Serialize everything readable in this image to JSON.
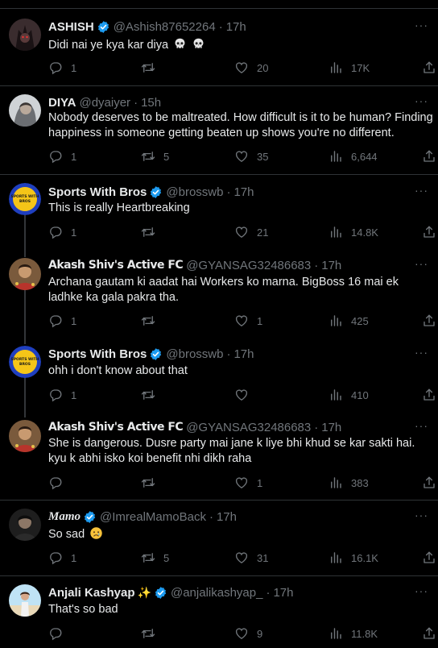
{
  "tweets": [
    {
      "name": "ASHISH",
      "verified": true,
      "handle": "@Ashish87652264",
      "time": "17h",
      "text": "Didi nai ye kya kar diya",
      "replies": "1",
      "retweets": "",
      "likes": "20",
      "views": "17K"
    },
    {
      "name": "DIYA",
      "verified": false,
      "handle": "@dyaiyer",
      "time": "15h",
      "text": "Nobody deserves to be maltreated. How difficult is it to be human? Finding happiness in someone getting beaten up shows you're no different.",
      "replies": "1",
      "retweets": "5",
      "likes": "35",
      "views": "6,644"
    },
    {
      "name": "Sports With Bros",
      "verified": true,
      "handle": "@brosswb",
      "time": "17h",
      "text": "This is really Heartbreaking",
      "replies": "1",
      "retweets": "",
      "likes": "21",
      "views": "14.8K"
    },
    {
      "name": "Akash Shiv's Active FC",
      "verified": false,
      "handle": "@GYANSAG32486683",
      "time": "17h",
      "text": "Archana gautam ki aadat hai Workers ko marna. BigBoss 16 mai ek ladhke ka gala pakra tha.",
      "replies": "1",
      "retweets": "",
      "likes": "1",
      "views": "425"
    },
    {
      "name": "Sports With Bros",
      "verified": true,
      "handle": "@brosswb",
      "time": "17h",
      "text": "ohh i don't know about that",
      "replies": "1",
      "retweets": "",
      "likes": "",
      "views": "410"
    },
    {
      "name": "Akash Shiv's Active FC",
      "verified": false,
      "handle": "@GYANSAG32486683",
      "time": "17h",
      "text": "She is dangerous.  Dusre party mai jane k liye bhi khud se kar sakti hai. kyu k abhi isko koi benefit nhi dikh raha",
      "replies": "",
      "retweets": "",
      "likes": "1",
      "views": "383"
    },
    {
      "name": "Mamo",
      "verified": true,
      "handle": "@ImrealMamoBack",
      "time": "17h",
      "text": "So sad",
      "replies": "1",
      "retweets": "5",
      "likes": "31",
      "views": "16.1K"
    },
    {
      "name": "Anjali Kashyap",
      "verified": true,
      "handle": "@anjalikashyap_",
      "time": "17h",
      "text": "That's so bad",
      "replies": "",
      "retweets": "",
      "likes": "9",
      "views": "11.8K"
    }
  ],
  "separator_dot": "·",
  "more_glyph": "···",
  "icons": {
    "reply": "reply-icon",
    "retweet": "retweet-icon",
    "like": "like-icon",
    "views": "views-icon",
    "share": "share-icon",
    "verified": "verified-badge-icon"
  },
  "colors": {
    "background": "#000000",
    "text": "#e7e9ea",
    "muted": "#71767b",
    "verified": "#1d9bf0",
    "border": "#2f3336"
  }
}
